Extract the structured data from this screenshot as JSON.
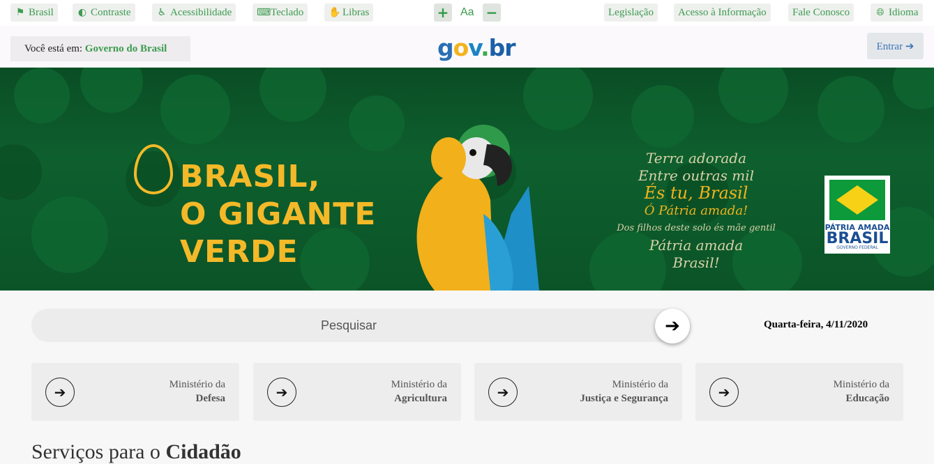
{
  "topbar": {
    "left_items": [
      {
        "label": "Brasil",
        "icon": "flag-icon"
      },
      {
        "label": "Contraste",
        "icon": "contrast-icon"
      },
      {
        "label": "Acessibilidade",
        "icon": "accessibility-icon"
      },
      {
        "label": "Teclado",
        "icon": "keyboard-icon"
      },
      {
        "label": "Libras",
        "icon": "sign-language-icon"
      }
    ],
    "font_size": {
      "increase": "+",
      "label": "Aa",
      "decrease": "−"
    },
    "right_items": [
      {
        "label": "Legislação"
      },
      {
        "label": "Acesso à Informação"
      },
      {
        "label": "Fale Conosco"
      },
      {
        "label": "Idioma",
        "icon": "globe-icon"
      }
    ]
  },
  "header": {
    "breadcrumb_prefix": "Você está em:",
    "breadcrumb_link": "Governo do Brasil",
    "logo": {
      "g": "g",
      "o": "o",
      "v": "v",
      "dot": ".",
      "b": "b",
      "r": "r"
    },
    "login_label": "Entrar"
  },
  "banner": {
    "title_lines": [
      "BRASIL,",
      "O GIGANTE",
      "VERDE"
    ],
    "poem": [
      "Terra adorada",
      "Entre outras mil",
      "És tu, Brasil",
      "Ó Pátria amada!",
      "Dos filhos deste solo és mãe gentil",
      "Pátria amada",
      "Brasil!"
    ],
    "seal": {
      "line1": "PÁTRIA AMADA",
      "line2": "BRASIL",
      "line3": "GOVERNO FEDERAL"
    }
  },
  "search": {
    "placeholder": "Pesquisar"
  },
  "date": "Quarta-feira, 4/11/2020",
  "ministries": [
    {
      "prefix": "Ministério da",
      "name": "Defesa"
    },
    {
      "prefix": "Ministério da",
      "name": "Agricultura"
    },
    {
      "prefix": "Ministério da",
      "name": "Justiça e Segurança"
    },
    {
      "prefix": "Ministério da",
      "name": "Educação"
    }
  ],
  "section": {
    "prefix": "Serviços para o",
    "bold": "Cidadão"
  },
  "colors": {
    "accent_green": "#3d9b4f",
    "banner_gold": "#f4b928",
    "link_blue": "#3a74b8"
  }
}
